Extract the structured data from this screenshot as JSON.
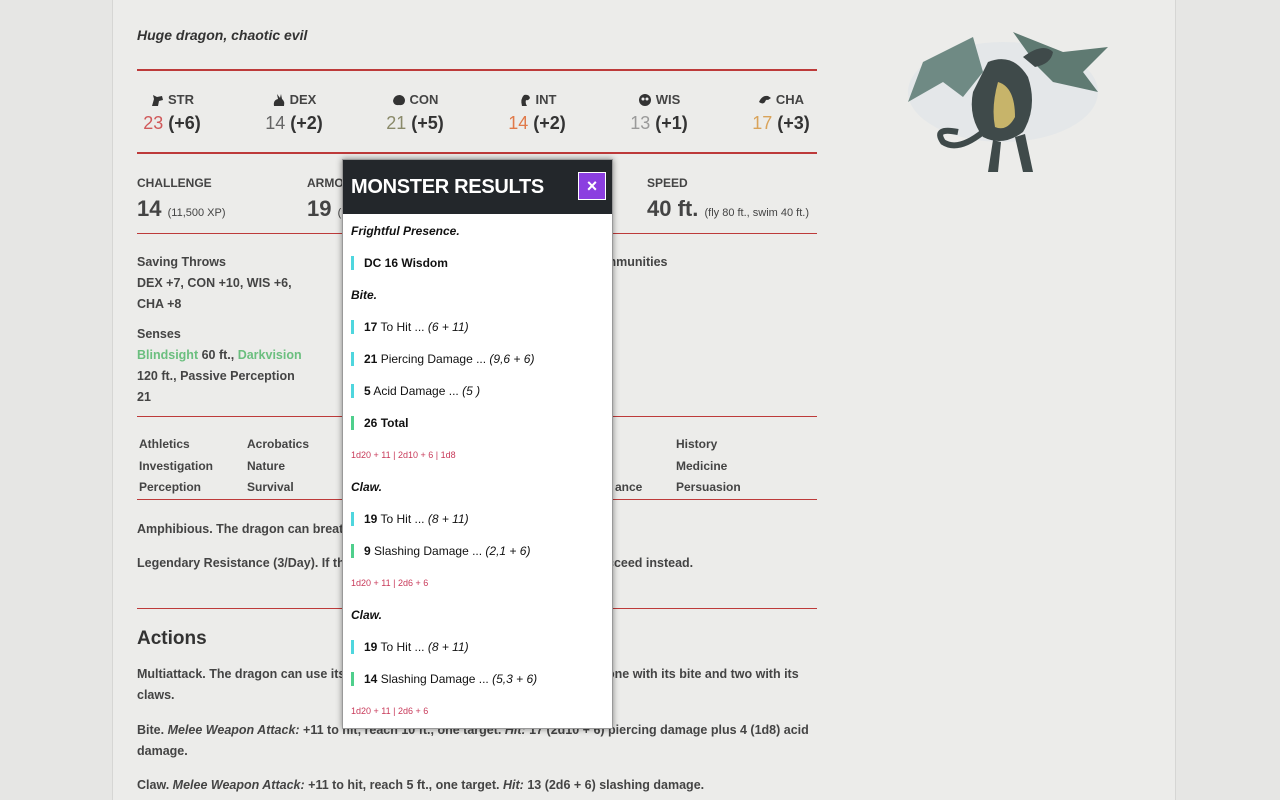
{
  "monster": {
    "subtitle": "Huge dragon, chaotic evil",
    "abilities": [
      {
        "label": "STR",
        "score": "23",
        "mod": "(+6)",
        "color": "#d0595a",
        "icon": "horse-head-icon"
      },
      {
        "label": "DEX",
        "score": "14",
        "mod": "(+2)",
        "color": "#666666",
        "icon": "rabbit-icon"
      },
      {
        "label": "CON",
        "score": "21",
        "mod": "(+5)",
        "color": "#8a8a6a",
        "icon": "bear-icon"
      },
      {
        "label": "INT",
        "score": "14",
        "mod": "(+2)",
        "color": "#e07a4a",
        "icon": "cobra-icon"
      },
      {
        "label": "WIS",
        "score": "13",
        "mod": "(+1)",
        "color": "#9a9a9a",
        "icon": "owl-icon"
      },
      {
        "label": "CHA",
        "score": "17",
        "mod": "(+3)",
        "color": "#d9a35a",
        "icon": "eagle-icon"
      }
    ],
    "challenge": {
      "label": "CHALLENGE",
      "value": "14",
      "xp": "(11,500 XP)"
    },
    "armor": {
      "label": "ARMO",
      "value": "19",
      "note": "(N"
    },
    "speed": {
      "label": "SPEED",
      "value": "40 ft.",
      "note": "(fly 80 ft., swim 40 ft.)"
    },
    "saving_throws": {
      "label": "Saving Throws",
      "line1": "DEX +7, CON +10, WIS +6,",
      "line2": "CHA +8"
    },
    "immunities_fragment": "mmunities",
    "senses": {
      "label": "Senses",
      "blindsight": "Blindsight",
      "blindsight_range": " 60 ft., ",
      "darkvision": "Darkvision",
      "line2": "120 ft., Passive Perception",
      "line3": "21"
    },
    "skills": [
      "Athletics",
      "Acrobatics",
      "History",
      "Investigation",
      "Nature",
      "Medicine",
      "Perception",
      "Survival",
      "ance",
      "Persuasion"
    ],
    "amphibious": "Amphibious. The dragon can breathe",
    "legendary_left": "Legendary Resistance (3/Day). If the",
    "legendary_right": "cceed instead.",
    "actions_heading": "Actions",
    "multiattack_left": "Multiattack. The dragon can use its F",
    "multiattack_right": "one with its bite and two with its",
    "multiattack_line2": "claws.",
    "bite_name": "Bite.",
    "bite_attack": "Melee Weapon Attack:",
    "bite_rest": "+11 to hit, reach 10 ft., one target.",
    "bite_hit": "Hit:",
    "bite_dmg": "17 (2d10 + 6) piercing damage plus 4 (1d8) acid",
    "bite_line2": "damage.",
    "claw_name": "Claw.",
    "claw_attack": "Melee Weapon Attack:",
    "claw_rest": "+11 to hit, reach 5 ft., one target.",
    "claw_hit": "Hit:",
    "claw_dmg": "13 (2d6 + 6) slashing damage."
  },
  "popup": {
    "title": "MONSTER RESULTS",
    "close_icon": "×",
    "frightful": "Frightful Presence.",
    "dc_num": "DC 16",
    "dc_label": " Wisdom",
    "bite_title": "Bite.",
    "bite_hit_num": "17",
    "bite_hit_label": " To Hit ... ",
    "bite_hit_formula": "(6 + 11)",
    "bite_pierce_num": "21",
    "bite_pierce_label": " Piercing Damage ... ",
    "bite_pierce_formula": "(9,6 + 6)",
    "bite_acid_num": "5",
    "bite_acid_label": " Acid Damage ... ",
    "bite_acid_formula": "(5 )",
    "bite_total_num": "26",
    "bite_total_label": " Total",
    "bite_roll": "1d20 + 11 | 2d10 + 6 | 1d8",
    "claw1_title": "Claw.",
    "claw1_hit_num": "19",
    "claw1_hit_label": " To Hit ... ",
    "claw1_hit_formula": "(8 + 11)",
    "claw1_dmg_num": "9",
    "claw1_dmg_label": " Slashing Damage ... ",
    "claw1_dmg_formula": "(2,1 + 6)",
    "claw1_roll": "1d20 + 11 | 2d6 + 6",
    "claw2_title": "Claw.",
    "claw2_hit_num": "19",
    "claw2_hit_label": " To Hit ... ",
    "claw2_hit_formula": "(8 + 11)",
    "claw2_dmg_num": "14",
    "claw2_dmg_label": " Slashing Damage ... ",
    "claw2_dmg_formula": "(5,3 + 6)",
    "claw2_roll": "1d20 + 11 | 2d6 + 6"
  }
}
